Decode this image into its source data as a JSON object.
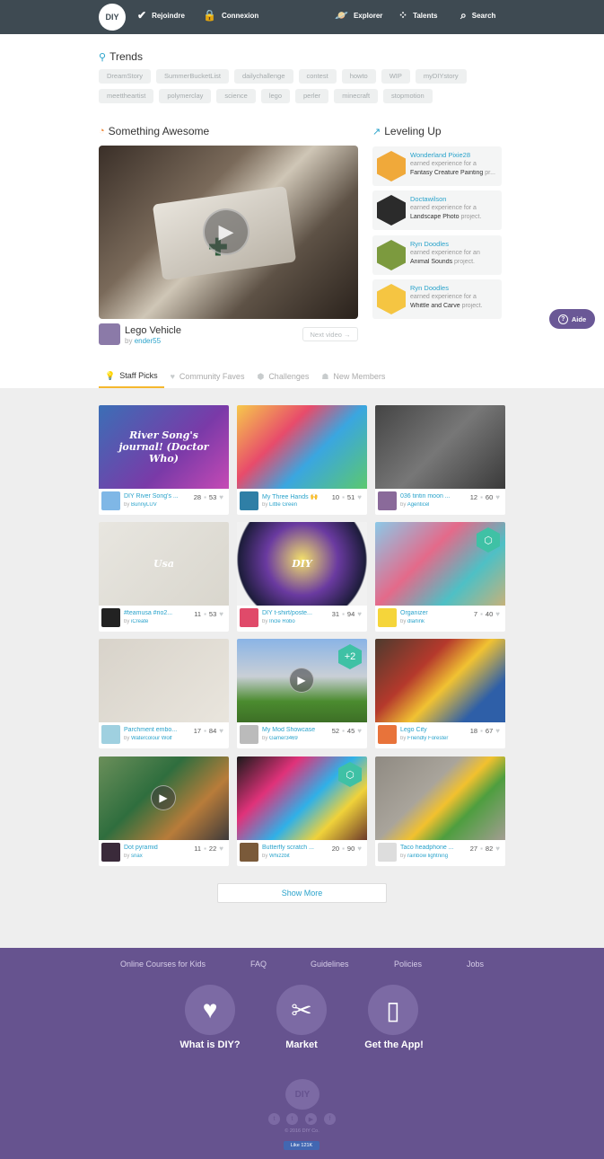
{
  "nav": {
    "logo": "DIY",
    "join": "Rejoindre",
    "login": "Connexion",
    "explore": "Explorer",
    "talents": "Talents",
    "search": "Search"
  },
  "trends": {
    "title": "Trends",
    "tags": [
      "DreamStory",
      "SummerBucketList",
      "dailychallenge",
      "contest",
      "howto",
      "WIP",
      "myDIYstory",
      "meettheartist",
      "polymerclay",
      "science",
      "lego",
      "perler",
      "minecraft",
      "stopmotion"
    ]
  },
  "awesome": {
    "title": "Something Awesome",
    "video_title": "Lego Vehicle",
    "by_prefix": "by",
    "author": "ender55",
    "next": "Next video →"
  },
  "leveling": {
    "title": "Leveling Up",
    "items": [
      {
        "user": "Wonderland Pixie28",
        "earned": "earned experience for a",
        "project": "Fantasy Creature Painting",
        "suffix": " pr..."
      },
      {
        "user": "Doctawilson",
        "earned": "earned experience for a",
        "project": "Landscape Photo",
        "suffix": " project."
      },
      {
        "user": "Ryn Doodles",
        "earned": "earned experience for an",
        "project": "Animal Sounds",
        "suffix": " project."
      },
      {
        "user": "Ryn Doodles",
        "earned": "earned experience for a",
        "project": "Whittle and Carve",
        "suffix": " project."
      }
    ]
  },
  "help": {
    "label": "Aide"
  },
  "tabs": [
    "Staff Picks",
    "Community Faves",
    "Challenges",
    "New Members"
  ],
  "cards": [
    {
      "title": "DIY River Song's ...",
      "by": "BunnyLUV",
      "comments": "28",
      "likes": "53",
      "img_text": "River Song's journal! (Doctor Who)"
    },
    {
      "title": "My Three Hands 🙌",
      "by": "Little Green",
      "comments": "10",
      "likes": "51"
    },
    {
      "title": "036 tintin moon ...",
      "by": "Agenticel",
      "comments": "12",
      "likes": "60"
    },
    {
      "title": "#teamusa #rio2...",
      "by": "iCreate",
      "comments": "11",
      "likes": "53",
      "img_text": "Usa"
    },
    {
      "title": "DIY t-shirt/poste...",
      "by": "Incle Robo",
      "comments": "31",
      "likes": "94",
      "img_text": "DIY"
    },
    {
      "title": "Organizer",
      "by": "dlarlink",
      "comments": "7",
      "likes": "40"
    },
    {
      "title": "Parchment embo...",
      "by": "Watercolour Wolf",
      "comments": "17",
      "likes": "84"
    },
    {
      "title": "My Mod Showcase",
      "by": "Gamer3469",
      "comments": "52",
      "likes": "45",
      "badge": "+2"
    },
    {
      "title": "Lego City",
      "by": "Friendly Forester",
      "comments": "18",
      "likes": "67"
    },
    {
      "title": "Dot pyramid",
      "by": "snax",
      "comments": "11",
      "likes": "22"
    },
    {
      "title": "Butterfly scratch ...",
      "by": "Whizzbit",
      "comments": "20",
      "likes": "90"
    },
    {
      "title": "Taco headphone ...",
      "by": "rainbow lightning",
      "comments": "27",
      "likes": "82"
    }
  ],
  "show_more": "Show More",
  "footer": {
    "links": [
      "Online Courses for Kids",
      "FAQ",
      "Guidelines",
      "Policies",
      "Jobs"
    ],
    "features": [
      "What is DIY?",
      "Market",
      "Get the App!"
    ],
    "logo": "DIY",
    "social": [
      "t",
      "t",
      "▶",
      "f"
    ],
    "copyright": "© 2016 DIY Co.",
    "like": "Like 121K"
  }
}
